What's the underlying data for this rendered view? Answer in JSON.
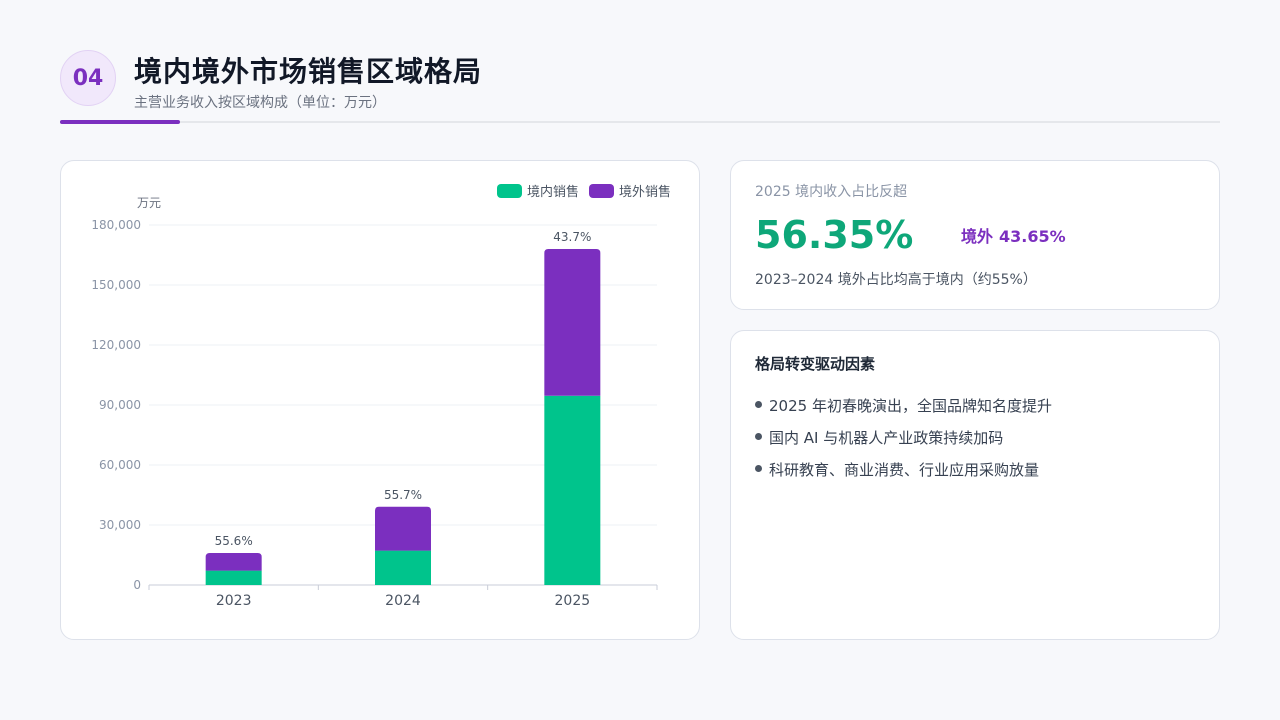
{
  "header": {
    "badge": "04",
    "title": "境内境外市场销售区域格局",
    "subtitle": "主营业务收入按区域构成（单位：万元）"
  },
  "chart_data": {
    "type": "bar",
    "stacked": true,
    "categories": [
      "2023",
      "2024",
      "2025"
    ],
    "series": [
      {
        "name": "境内销售",
        "color": "#00c48c",
        "values": [
          7200,
          17200,
          94600
        ]
      },
      {
        "name": "境外销售",
        "color": "#7b2fbf",
        "values": [
          8800,
          21900,
          73400
        ]
      }
    ],
    "bar_labels": [
      "55.6%",
      "55.7%",
      "43.7%"
    ],
    "ylabel": "万元",
    "ylim": [
      0,
      180000
    ],
    "yticks": [
      0,
      30000,
      60000,
      90000,
      120000,
      150000,
      180000
    ],
    "ytick_labels": [
      "0",
      "30,000",
      "60,000",
      "90,000",
      "120,000",
      "150,000",
      "180,000"
    ],
    "legend_position": "top-right",
    "grid": true
  },
  "stat": {
    "label": "2025 境内收入占比反超",
    "value": "56.35%",
    "side_label": "境外",
    "side_value": "43.65%",
    "note": "2023–2024 境外占比均高于境内（约55%）"
  },
  "drivers": {
    "title": "格局转变驱动因素",
    "items": [
      "2025 年初春晚演出，全国品牌知名度提升",
      "国内 AI 与机器人产业政策持续加码",
      "科研教育、商业消费、行业应用采购放量"
    ]
  }
}
